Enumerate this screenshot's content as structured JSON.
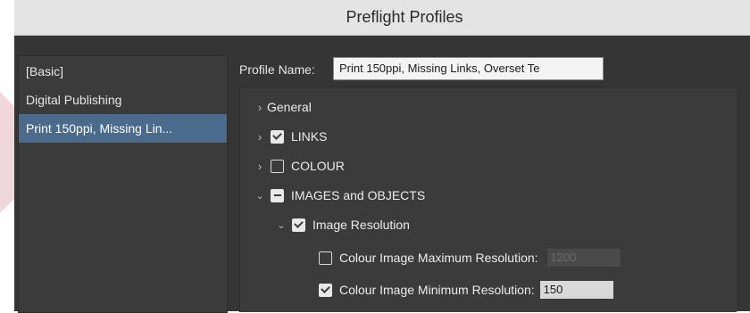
{
  "dialog": {
    "title": "Preflight Profiles"
  },
  "profiles": {
    "items": [
      {
        "label": "[Basic]"
      },
      {
        "label": "Digital Publishing"
      },
      {
        "label": "Print 150ppi, Missing Lin..."
      }
    ],
    "selected_index": 2
  },
  "profile_name": {
    "label": "Profile Name:",
    "value": "Print 150ppi, Missing Links, Overset Te"
  },
  "tree": {
    "general": {
      "label": "General"
    },
    "links": {
      "label": "LINKS",
      "checked": true
    },
    "colour": {
      "label": "COLOUR",
      "checked": false
    },
    "images_objects": {
      "label": "IMAGES and OBJECTS",
      "state": "mixed"
    },
    "image_resolution": {
      "label": "Image Resolution",
      "checked": true
    },
    "colour_max": {
      "label": "Colour Image Maximum Resolution:",
      "checked": false,
      "value": "1200"
    },
    "colour_min": {
      "label": "Colour Image Minimum Resolution:",
      "checked": true,
      "value": "150"
    }
  },
  "colors": {
    "selection": "#4a6b8c",
    "background": "#3a3a3a",
    "titlebar": "#e4e4e4"
  }
}
